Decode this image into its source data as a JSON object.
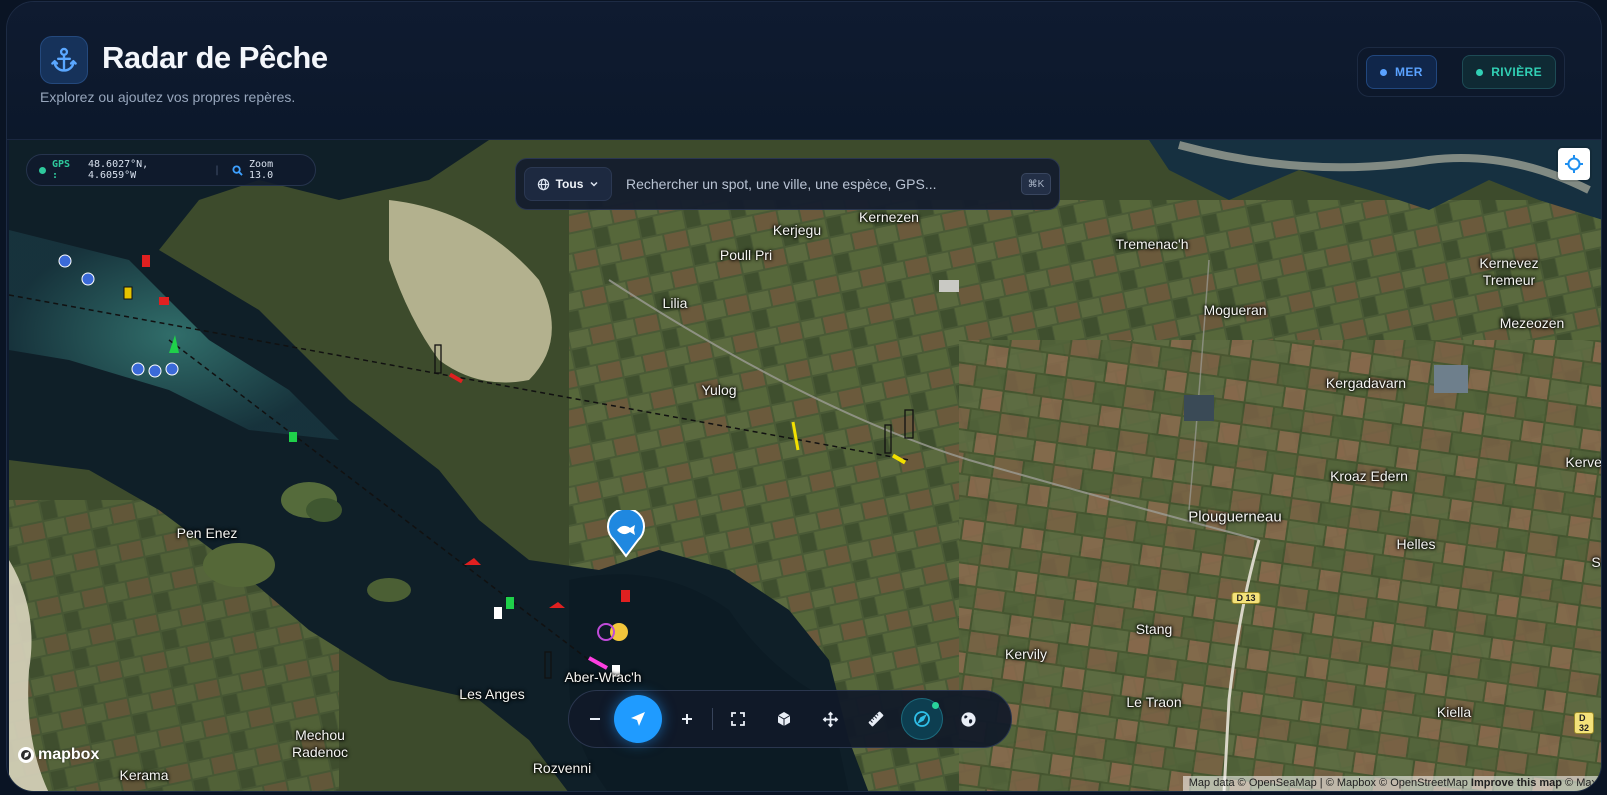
{
  "header": {
    "title": "Radar de Pêche",
    "subtitle": "Explorez ou ajoutez vos propres repères.",
    "logo_icon": "anchor-icon",
    "modes": [
      {
        "label": "MER",
        "color": "#5aa2ff"
      },
      {
        "label": "RIVIÈRE",
        "color": "#31d0b5"
      }
    ]
  },
  "gps": {
    "prefix": "GPS :",
    "coords": "48.6027°N, 4.6059°W",
    "zoom": "Zoom 13.0"
  },
  "search": {
    "filter_label": "Tous",
    "placeholder": "Rechercher un spot, une ville, une espèce, GPS...",
    "shortcut": "⌘K"
  },
  "map": {
    "labels": [
      "Kerjegu",
      "Kernezen",
      "Poull Pri",
      "Lilia",
      "Tremenac'h",
      "Kernevez",
      "Tremeur",
      "Mogueran",
      "Mezeozen",
      "Yulog",
      "Kergadavarn",
      "Kroaz Edern",
      "Kerver",
      "Pen Enez",
      "Plouguerneau",
      "Helles",
      "S",
      "Stang",
      "Kervily",
      "Aber-Wrac'h",
      "Les Anges",
      "Le Traon",
      "Kiella",
      "Mechou",
      "Radenoc",
      "Rozvenni",
      "Kerama"
    ],
    "road_shields": [
      "D 13",
      "D 32"
    ],
    "spot_marker_icon": "fish-icon"
  },
  "toolbar": {
    "buttons": [
      "zoom-out",
      "navigate",
      "zoom-in",
      "fullscreen",
      "3d-view",
      "pan",
      "measure",
      "compass",
      "globe"
    ]
  },
  "footer": {
    "brand": "mapbox",
    "attribution_1": "Map data © OpenSeaMap",
    "attribution_2": " | © Mapbox © OpenStreetMap ",
    "attribution_3": "Improve this map",
    "attribution_4": " © Max"
  }
}
